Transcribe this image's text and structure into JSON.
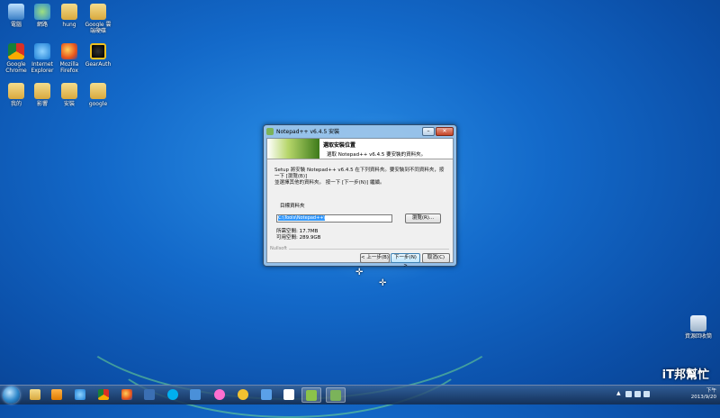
{
  "desktop": {
    "icons": [
      {
        "label": "電腦",
        "icon": "computer-icon"
      },
      {
        "label": "網路",
        "icon": "network-icon"
      },
      {
        "label": "hung",
        "icon": "folder-icon"
      },
      {
        "label": "Google 雲端硬碟",
        "icon": "folder-icon"
      },
      {
        "label": "Google Chrome",
        "icon": "chrome-icon"
      },
      {
        "label": "Internet Explorer",
        "icon": "ie-icon"
      },
      {
        "label": "Mozilla Firefox",
        "icon": "firefox-icon"
      },
      {
        "label": "GearAuth",
        "icon": "gear-icon"
      },
      {
        "label": "我的",
        "icon": "folder-icon"
      },
      {
        "label": "影響",
        "icon": "folder-icon"
      },
      {
        "label": "安裝",
        "icon": "folder-icon"
      },
      {
        "label": "google",
        "icon": "folder-icon"
      }
    ],
    "recycle_bin": "資源回收筒"
  },
  "dialog": {
    "title": "Notepad++ v6.4.5 安裝",
    "header_title": "選取安裝位置",
    "header_subtitle": "選取 Notepad++ v6.4.5 要安裝的資料夾。",
    "description_line1": "Setup 將安裝 Notepad++ v6.4.5 在下列資料夾。要安裝到不同資料夾，按一下 [瀏覽(B)]",
    "description_line2": "並選擇其他的資料夾。 按一下 [下一步(N)] 繼續。",
    "group_label": "目標資料夾",
    "path_value": "C:\\Tools\\Notepad++\\",
    "browse_label": "瀏覽(R)...",
    "space_required": "所需空間: 17.7MB",
    "space_available": "可用空間: 289.9GB",
    "brand": "Nullsoft",
    "back_label": "< 上一步(B)",
    "next_label": "下一步(N) >",
    "cancel_label": "取消(C)"
  },
  "taskbar": {
    "date": "2013/9/20",
    "time": "下午",
    "logo": "iT邦幫忙"
  }
}
